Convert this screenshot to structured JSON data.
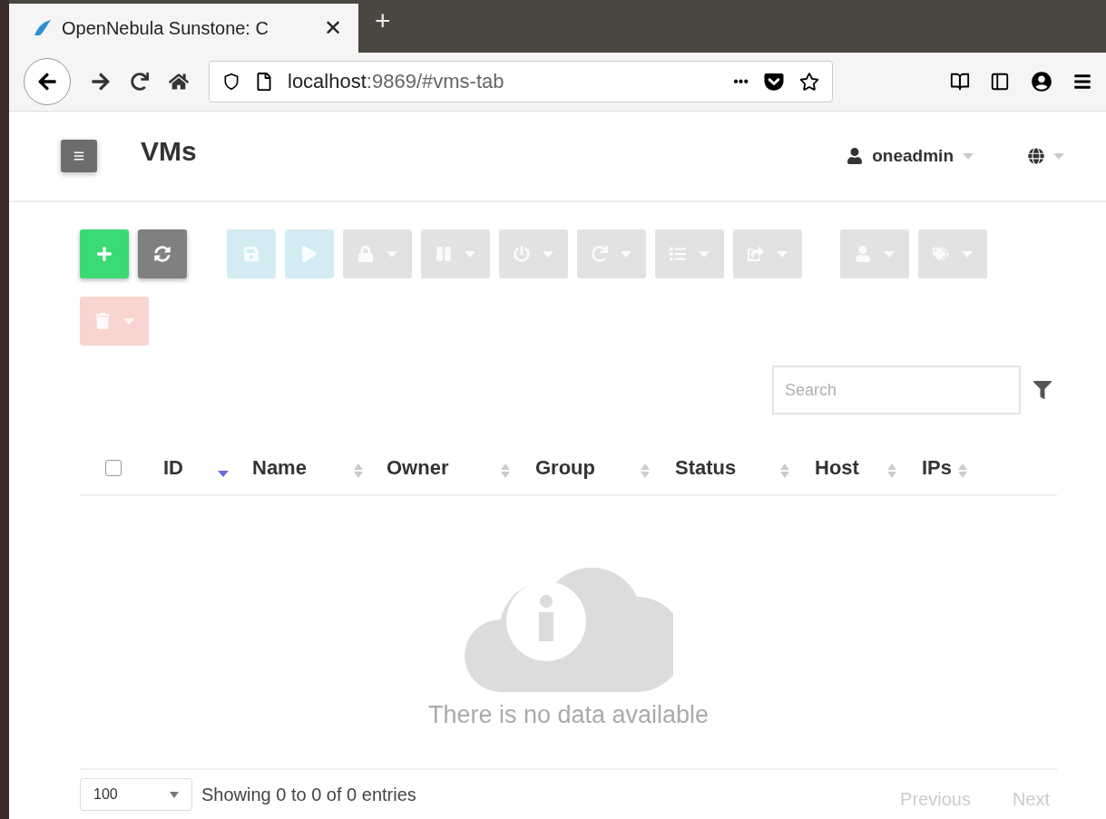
{
  "browser": {
    "tab_title": "OpenNebula Sunstone: C",
    "tab_close": "✕",
    "new_tab": "+",
    "url_host": "localhost",
    "url_rest": ":9869/#vms-tab",
    "url_more": "•••"
  },
  "header": {
    "title": "VMs",
    "user": "oneadmin"
  },
  "toolbar": [
    {
      "kind": "plain",
      "color": "#3adb76",
      "disabled": false
    },
    {
      "kind": "plain",
      "color": "#808080",
      "disabled": false
    },
    {
      "kind": "plain",
      "color": "#d3ecf3",
      "disabled": true
    },
    {
      "kind": "plain",
      "color": "#d3ecf3",
      "disabled": true
    },
    {
      "kind": "menu",
      "color": "#e2e2e2",
      "disabled": true
    },
    {
      "kind": "menu",
      "color": "#e2e2e2",
      "disabled": true
    },
    {
      "kind": "menu",
      "color": "#e2e2e2",
      "disabled": true
    },
    {
      "kind": "menu",
      "color": "#e2e2e2",
      "disabled": true
    },
    {
      "kind": "menu",
      "color": "#e2e2e2",
      "disabled": true
    },
    {
      "kind": "menu",
      "color": "#e2e2e2",
      "disabled": true
    },
    {
      "kind": "menu",
      "color": "#e2e2e2",
      "disabled": true
    },
    {
      "kind": "menu",
      "color": "#e2e2e2",
      "disabled": true
    },
    {
      "kind": "menu",
      "color": "#f8d5d0",
      "disabled": true
    }
  ],
  "search": {
    "placeholder": "Search"
  },
  "table": {
    "select_all": {
      "checked": false
    },
    "columns": [
      {
        "label": "ID",
        "sorted": true
      },
      {
        "label": "Name",
        "sorted": false
      },
      {
        "label": "Owner",
        "sorted": false
      },
      {
        "label": "Group",
        "sorted": false
      },
      {
        "label": "Status",
        "sorted": false
      },
      {
        "label": "Host",
        "sorted": false
      },
      {
        "label": "IPs",
        "sorted": false
      }
    ],
    "empty_message": "There is no data available"
  },
  "footer": {
    "page_size": "100",
    "info": "Showing 0 to 0 of 0 entries",
    "previous": "Previous",
    "next": "Next"
  }
}
